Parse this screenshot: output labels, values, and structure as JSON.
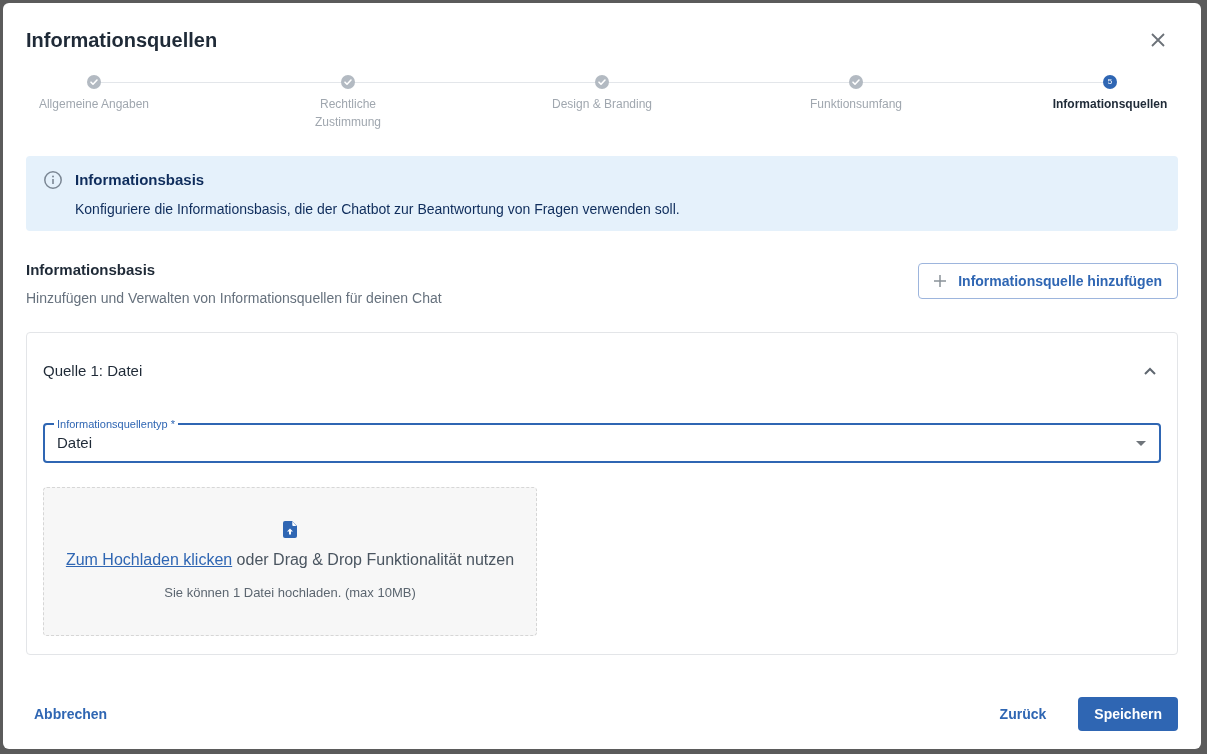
{
  "dialog": {
    "title": "Informationsquellen"
  },
  "stepper": [
    {
      "label": "Allgemeine Angaben",
      "completed": true,
      "selected": false
    },
    {
      "label": "Rechtliche Zustimmung",
      "completed": true,
      "selected": false
    },
    {
      "label": "Design & Branding",
      "completed": true,
      "selected": false
    },
    {
      "label": "Funktionsumfang",
      "completed": true,
      "selected": false
    },
    {
      "label": "Informationsquellen",
      "completed": false,
      "selected": true,
      "number": "5"
    }
  ],
  "alert": {
    "kind": "info",
    "title": "Informationsbasis",
    "message": "Konfiguriere die Informationsbasis, die der Chatbot zur Beantwortung von Fragen verwenden soll."
  },
  "section": {
    "title": "Informationsbasis",
    "subtitle": "Hinzufügen und Verwalten von Informationsquellen für deinen Chat",
    "add_button": "Informationsquelle hinzufügen"
  },
  "sources": [
    {
      "title": "Quelle 1: Datei",
      "expanded": true,
      "type_field": {
        "label": "Informationsquellentyp *",
        "value": "Datei",
        "focused": true
      },
      "upload": {
        "link": "Zum Hochladen klicken",
        "text": "oder Drag & Drop Funktionalität nutzen",
        "hint": "Sie können 1 Datei hochladen. (max 10MB)"
      }
    }
  ],
  "footer": {
    "cancel_button": "Abbrechen",
    "back_button": "Zurück",
    "save_button": "Speichern"
  }
}
